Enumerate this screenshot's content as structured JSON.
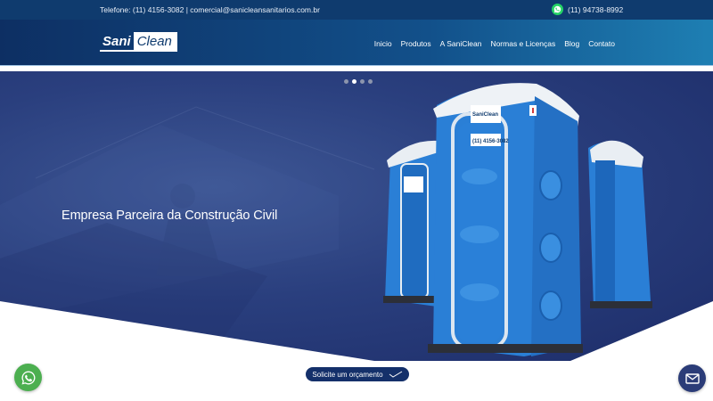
{
  "topbar": {
    "contact": "Telefone: (11) 4156-3082 | comercial@sanicleansanitarios.com.br",
    "whatsapp_number": "(11) 94738-8992",
    "icon": "whatsapp-icon"
  },
  "header": {
    "logo_sani": "Sani",
    "logo_clean": "Clean",
    "nav": [
      "Inicio",
      "Produtos",
      "A SaniClean",
      "Normas e Licenças",
      "Blog",
      "Contato"
    ]
  },
  "hero": {
    "title": "Empresa Parceira da Construção Civil",
    "slider_dots": 4,
    "active_dot": 2,
    "toilet_phone": "(11) 4156-3082",
    "toilet_brand": "SaniClean"
  },
  "cta": {
    "label": "Solicite um orçamento",
    "icon": "check-arrow-icon"
  },
  "floating": {
    "whatsapp_icon": "whatsapp-icon",
    "mail_icon": "mail-icon"
  },
  "colors": {
    "topbar": "#0f3b6e",
    "hero_dark": "#1d2d69",
    "toilet_blue": "#2a7fd6",
    "whatsapp_green": "#4caf50",
    "cta_bg": "#14306a"
  }
}
